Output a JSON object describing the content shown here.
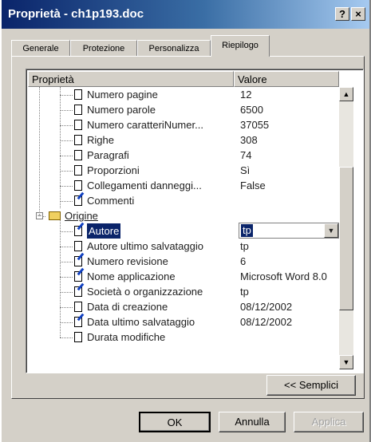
{
  "window": {
    "title": "Proprietà - ch1p193.doc",
    "help_label": "?",
    "close_label": "×"
  },
  "tabs": [
    {
      "label": "Generale"
    },
    {
      "label": "Protezione"
    },
    {
      "label": "Personalizza"
    },
    {
      "label": "Riepilogo",
      "active": true
    }
  ],
  "list": {
    "columns": {
      "name": "Proprietà",
      "value": "Valore"
    },
    "rows": [
      {
        "name": "Numero pagine",
        "value": "12",
        "icon": "page-icon"
      },
      {
        "name": "Numero parole",
        "value": "6500",
        "icon": "page-icon"
      },
      {
        "name": "Numero caratteriNumer...",
        "value": "37055",
        "icon": "page-icon"
      },
      {
        "name": "Righe",
        "value": "308",
        "icon": "page-icon"
      },
      {
        "name": "Paragrafi",
        "value": "74",
        "icon": "page-icon"
      },
      {
        "name": "Proporzioni",
        "value": "Sì",
        "icon": "page-icon"
      },
      {
        "name": "Collegamenti danneggi...",
        "value": "False",
        "icon": "page-icon"
      },
      {
        "name": "Commenti",
        "value": "",
        "icon": "edit-icon"
      },
      {
        "name": "Origine",
        "value": "",
        "icon": "folder-icon",
        "group": true,
        "expander": "−"
      },
      {
        "name": "Autore",
        "value": "tp",
        "icon": "edit-icon",
        "selected": true
      },
      {
        "name": "Autore ultimo salvataggio",
        "value": "tp",
        "icon": "page-icon"
      },
      {
        "name": "Numero revisione",
        "value": "6",
        "icon": "edit-icon"
      },
      {
        "name": "Nome applicazione",
        "value": "Microsoft Word 8.0",
        "icon": "edit-icon"
      },
      {
        "name": "Società o organizzazione",
        "value": "tp",
        "icon": "edit-icon"
      },
      {
        "name": "Data di creazione",
        "value": "08/12/2002",
        "icon": "page-icon"
      },
      {
        "name": "Data ultimo salvataggio",
        "value": "08/12/2002",
        "icon": "edit-icon"
      },
      {
        "name": "Durata modifiche",
        "value": "",
        "icon": "page-icon"
      }
    ],
    "combo_arrow": "▼",
    "scroll_up": "▲",
    "scroll_down": "▼"
  },
  "buttons": {
    "simple": "<< Semplici",
    "ok": "OK",
    "cancel": "Annulla",
    "apply": "Applica"
  },
  "colors": {
    "title_bar": "#0a246a",
    "selection": "#0a246a",
    "face": "#d4d0c8"
  }
}
